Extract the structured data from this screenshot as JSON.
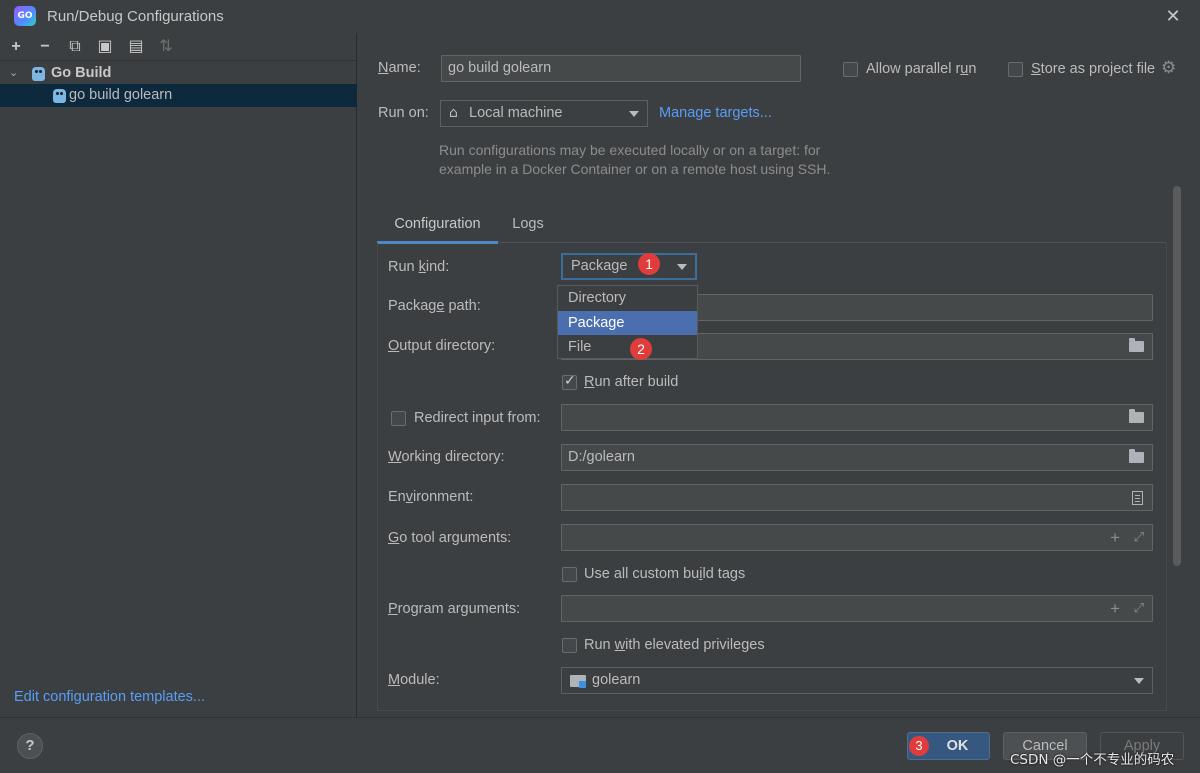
{
  "window": {
    "title": "Run/Debug Configurations",
    "app_icon_text": "GO"
  },
  "toolbar": {
    "add": "+",
    "remove": "−",
    "copy": "⧉",
    "save": "▣",
    "folder": "▤",
    "sort": "⇅"
  },
  "tree": {
    "root": {
      "label": "Go Build",
      "expanded": true
    },
    "child": {
      "label": "go build golearn",
      "selected": true
    }
  },
  "left_footer": {
    "edit_templates": "Edit configuration templates..."
  },
  "form": {
    "name_label_pre": "",
    "name_label_u": "N",
    "name_label_post": "ame:",
    "name_value": "go build golearn",
    "allow_parallel_pre": "Allow parallel r",
    "allow_parallel_u": "u",
    "allow_parallel_post": "n",
    "store_project_pre": "",
    "store_project_u": "S",
    "store_project_post": "tore as project file",
    "run_on_label": "Run on:",
    "run_on_value": "Local machine",
    "manage_targets": "Manage targets...",
    "hint_line1": "Run configurations may be executed locally or on a target: for",
    "hint_line2": "example in a Docker Container or on a remote host using SSH."
  },
  "tabs": [
    {
      "label": "Configuration",
      "active": true
    },
    {
      "label": "Logs",
      "active": false
    }
  ],
  "config": {
    "run_kind_pre": "Run ",
    "run_kind_u": "k",
    "run_kind_post": "ind:",
    "run_kind_value": "Package",
    "package_path_pre": "Packag",
    "package_path_u": "e",
    "package_path_post": " path:",
    "output_dir_pre": "",
    "output_dir_u": "O",
    "output_dir_post": "utput directory:",
    "run_after_build_pre": "",
    "run_after_build_u": "R",
    "run_after_build_post": "un after build",
    "redirect_input": "Redirect input from:",
    "working_dir_pre": "",
    "working_dir_u": "W",
    "working_dir_post": "orking directory:",
    "working_dir_value": "D:/golearn",
    "environment_pre": "En",
    "environment_u": "v",
    "environment_post": "ironment:",
    "go_tool_args_pre": "",
    "go_tool_args_u": "G",
    "go_tool_args_post": "o tool arguments:",
    "custom_build_tags_pre": "Use all custom bu",
    "custom_build_tags_u": "i",
    "custom_build_tags_post": "ld tags",
    "program_args_pre": "",
    "program_args_u": "P",
    "program_args_post": "rogram arguments:",
    "elevated_pre": "Run ",
    "elevated_u": "w",
    "elevated_post": "ith elevated privileges",
    "module_pre": "",
    "module_u": "M",
    "module_post": "odule:",
    "module_value": "golearn"
  },
  "dropdown": {
    "options": [
      "Directory",
      "Package",
      "File"
    ],
    "selected": "Package"
  },
  "badges": {
    "one": "1",
    "two": "2",
    "three": "3"
  },
  "buttons": {
    "help": "?",
    "ok": "OK",
    "cancel": "Cancel",
    "apply": "Apply"
  },
  "watermark": "CSDN @一个不专业的码农",
  "colors": {
    "bg": "#3c3f41",
    "link": "#589df6",
    "selection": "#4b6eaf",
    "tree_selection": "#0d293e",
    "primary_button": "#365880",
    "badge": "#e03c3c"
  }
}
